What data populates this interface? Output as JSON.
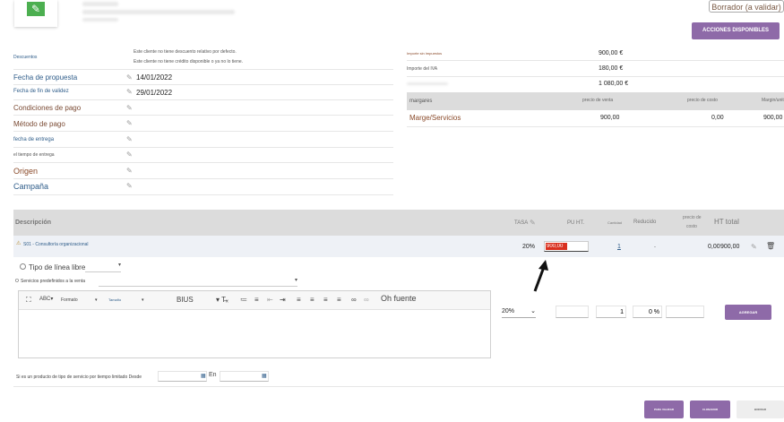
{
  "header": {
    "status_badge": "Borrador (a validar)",
    "actions_button": "ACCIONES DISPONIBLES"
  },
  "left_fields": {
    "descuentos_label": "Descuentos",
    "descuentos_line1": "Este cliente no tiene descuento relativo por defecto.",
    "descuentos_line2": "Este cliente no tiene crédito disponible o ya no lo tiene.",
    "fecha_propuesta_label": "Fecha de propuesta",
    "fecha_propuesta_value": "14/01/2022",
    "fecha_validez_label": "Fecha de fin de validez",
    "fecha_validez_value": "29/01/2022",
    "condiciones_label": "Condiciones de pago",
    "metodo_label": "Método de pago",
    "fecha_entrega_label": "fecha de entrega",
    "tiempo_entrega_label": "el tiempo de entrega",
    "origen_label": "Origen",
    "campana_label": "Campaña"
  },
  "totals": {
    "importe_sin_impuestos_label": "Importe sin impuestos",
    "importe_sin_impuestos_value": "900,00 €",
    "importe_iva_label": "Importe del IVA",
    "importe_iva_value": "180,00 €",
    "importe_total_value": "1 080,00 €"
  },
  "margins": {
    "header_label": "margares",
    "col_precio_venta": "precio de venta",
    "col_precio_costo": "precio de costo",
    "col_margin": "Margin/unit",
    "row_label": "Marge/Servicios",
    "row_precio_venta": "900,00",
    "row_precio_costo": "0,00",
    "row_margin": "900,00"
  },
  "lines_table": {
    "col_descripcion": "Descripción",
    "col_tasa": "TASA",
    "col_pu_ht": "PU HT.",
    "col_cantidad": "Cantidad",
    "col_reducido": "Reducido",
    "col_precio_costo_1": "precio de",
    "col_precio_costo_2": "costo",
    "col_ht_total": "HT total",
    "row1_desc": "S01 - Consultoría organizacional",
    "row1_tasa": "20%",
    "row1_pu": "900,00",
    "row1_qty": "1",
    "row1_reducido": ".",
    "row1_costo": "0,00",
    "row1_total": "900,00"
  },
  "add_line": {
    "free_type_label": "Tipo de línea libre",
    "predefined_label": "Servicios predefinidos a la venta",
    "toolbar_format": "Formato",
    "toolbar_size": "Tamaño",
    "toolbar_bius": "BIUS",
    "toolbar_font": "Oh fuente",
    "vat_select": "20%",
    "qty_value": "1",
    "discount_value": "0 %",
    "add_button": "AGREGAR",
    "service_period_label": "Si es un producto de tipo de servicio por tiempo limitado Desde",
    "en_label": "En"
  },
  "footer": {
    "validate_button": "PARA VALIDAR",
    "clone_button": "CLONADOR",
    "delete_button": "BORRAR"
  }
}
